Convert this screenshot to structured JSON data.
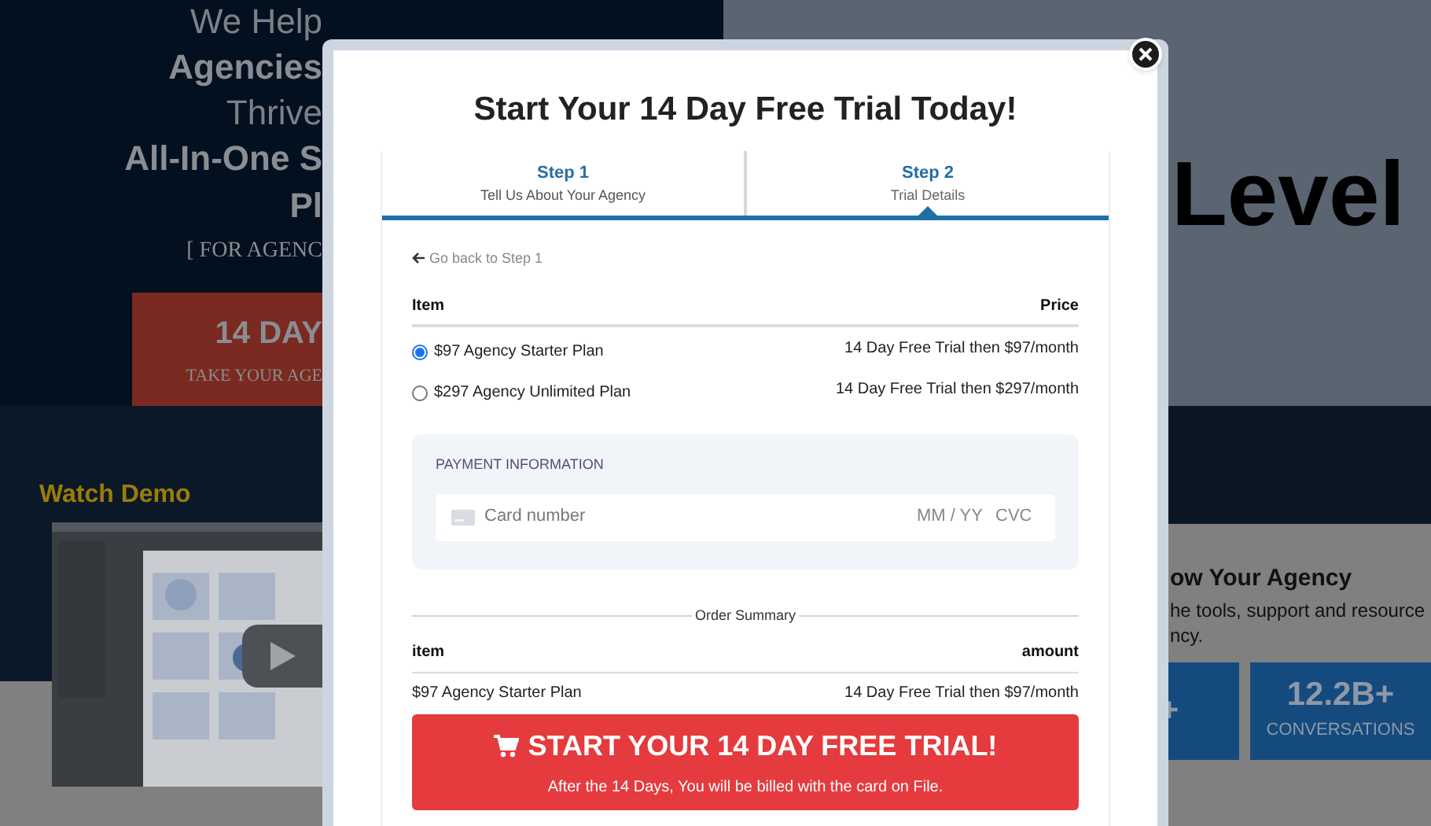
{
  "background": {
    "hero_lines": [
      {
        "text": "We Help",
        "kind": "light"
      },
      {
        "text": "Agencies",
        "kind": "bold"
      },
      {
        "text": "Thrive",
        "kind": "light"
      },
      {
        "text": "All-In-One S",
        "kind": "bold"
      },
      {
        "text": "Pl",
        "kind": "bold"
      },
      {
        "text": "[ FOR AGENC",
        "kind": "serif"
      }
    ],
    "hero_button": {
      "title": "14 DAY",
      "subtitle": "TAKE YOUR AGE"
    },
    "watch_demo": "Watch Demo",
    "headline_right": "Level",
    "grow_heading": "ow Your Agency",
    "grow_text_lines": [
      "he tools, support and resource",
      "ncy."
    ],
    "stats": [
      {
        "value": "+"
      },
      {
        "value": "12.2B+",
        "label": "CONVERSATIONS"
      }
    ]
  },
  "modal": {
    "title": "Start Your 14 Day Free Trial Today!",
    "steps": [
      {
        "title": "Step 1",
        "subtitle": "Tell Us About Your Agency",
        "selected": false
      },
      {
        "title": "Step 2",
        "subtitle": "Trial Details",
        "selected": true
      }
    ],
    "back_link": "Go back to Step 1",
    "plans": {
      "columns": [
        "Item",
        "Price"
      ],
      "rows": [
        {
          "name": "$97 Agency Starter Plan",
          "price": "14 Day Free Trial then $97/month",
          "selected": true
        },
        {
          "name": "$297 Agency Unlimited Plan",
          "price": "14 Day Free Trial then $297/month",
          "selected": false
        }
      ]
    },
    "payment": {
      "heading": "PAYMENT INFORMATION",
      "card_placeholder": "Card number",
      "expiry_placeholder": "MM / YY",
      "cvc_placeholder": "CVC"
    },
    "order_summary": {
      "heading": "Order Summary",
      "columns": [
        "item",
        "amount"
      ],
      "rows": [
        {
          "item": "$97 Agency Starter Plan",
          "amount": "14 Day Free Trial then $97/month"
        }
      ]
    },
    "cta": {
      "title": "START YOUR 14 DAY FREE TRIAL!",
      "note": "After the 14 Days, You will be billed with the card on File."
    }
  }
}
